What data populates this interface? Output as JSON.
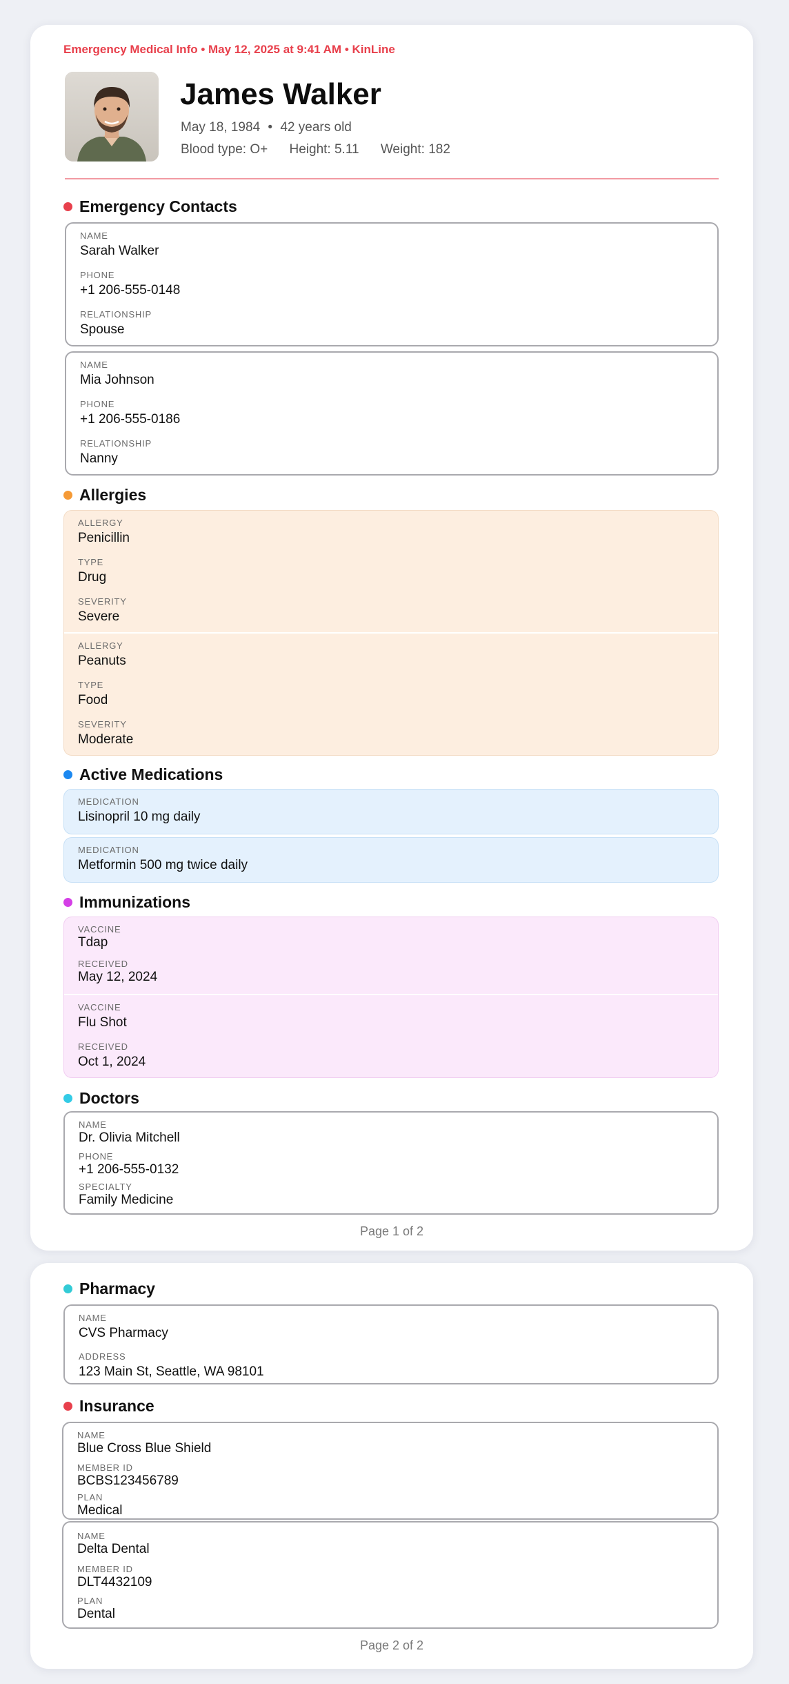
{
  "header": {
    "topline": "Emergency Medical Info • May 12, 2025 at 9:41 AM • KinLine",
    "name": "James Walker",
    "dob": "May 18, 1984",
    "age": "42 years old",
    "blood_type": "Blood type: O+",
    "height": "Height: 5.11",
    "weight": "Weight: 182"
  },
  "sections": {
    "emergency_contacts": "Emergency Contacts",
    "allergies": "Allergies",
    "medications": "Active Medications",
    "immunizations": "Immunizations",
    "doctors": "Doctors",
    "pharmacy": "Pharmacy",
    "insurance": "Insurance"
  },
  "colors": {
    "accent_red": "#e8404c",
    "allergies_dot": "#f59a36",
    "medications_dot": "#1c88f0",
    "immunizations_dot": "#d43fe6",
    "doctors_dot": "#33cbe6",
    "pharmacy_dot": "#33cbd6",
    "insurance_dot": "#e8404c"
  },
  "contacts": [
    {
      "name_label": "NAME",
      "name": "Sarah Walker",
      "phone_label": "PHONE",
      "phone": "+1 206-555-0148",
      "rel_label": "RELATIONSHIP",
      "relationship": "Spouse"
    },
    {
      "name_label": "NAME",
      "name": "Mia Johnson",
      "phone_label": "PHONE",
      "phone": "+1 206-555-0186",
      "rel_label": "RELATIONSHIP",
      "relationship": "Nanny"
    }
  ],
  "allergies": [
    {
      "allergy_label": "ALLERGY",
      "allergy": "Penicillin",
      "type_label": "TYPE",
      "type": "Drug",
      "severity_label": "SEVERITY",
      "severity": "Severe"
    },
    {
      "allergy_label": "ALLERGY",
      "allergy": "Peanuts",
      "type_label": "TYPE",
      "type": "Food",
      "severity_label": "SEVERITY",
      "severity": "Moderate"
    }
  ],
  "medications": [
    {
      "label": "MEDICATION",
      "value": "Lisinopril 10 mg daily"
    },
    {
      "label": "MEDICATION",
      "value": "Metformin 500 mg twice daily"
    }
  ],
  "immunizations": [
    {
      "vaccine_label": "VACCINE",
      "vaccine": "Tdap",
      "received_label": "RECEIVED",
      "received": "May 12, 2024"
    },
    {
      "vaccine_label": "VACCINE",
      "vaccine": "Flu Shot",
      "received_label": "RECEIVED",
      "received": "Oct 1, 2024"
    }
  ],
  "doctors": [
    {
      "name_label": "NAME",
      "name": "Dr. Olivia Mitchell",
      "phone_label": "PHONE",
      "phone": "+1 206-555-0132",
      "specialty_label": "SPECIALTY",
      "specialty": "Family Medicine"
    }
  ],
  "pharmacy": {
    "name_label": "NAME",
    "name": "CVS Pharmacy",
    "address_label": "ADDRESS",
    "address": "123 Main St, Seattle, WA 98101"
  },
  "insurance": [
    {
      "name_label": "NAME",
      "name": "Blue Cross Blue Shield",
      "member_label": "MEMBER ID",
      "member_id": "BCBS123456789",
      "plan_label": "PLAN",
      "plan": "Medical"
    },
    {
      "name_label": "NAME",
      "name": "Delta Dental",
      "member_label": "MEMBER ID",
      "member_id": "DLT4432109",
      "plan_label": "PLAN",
      "plan": "Dental"
    }
  ],
  "pages": {
    "page1": "Page 1 of 2",
    "page2": "Page 2 of 2"
  }
}
